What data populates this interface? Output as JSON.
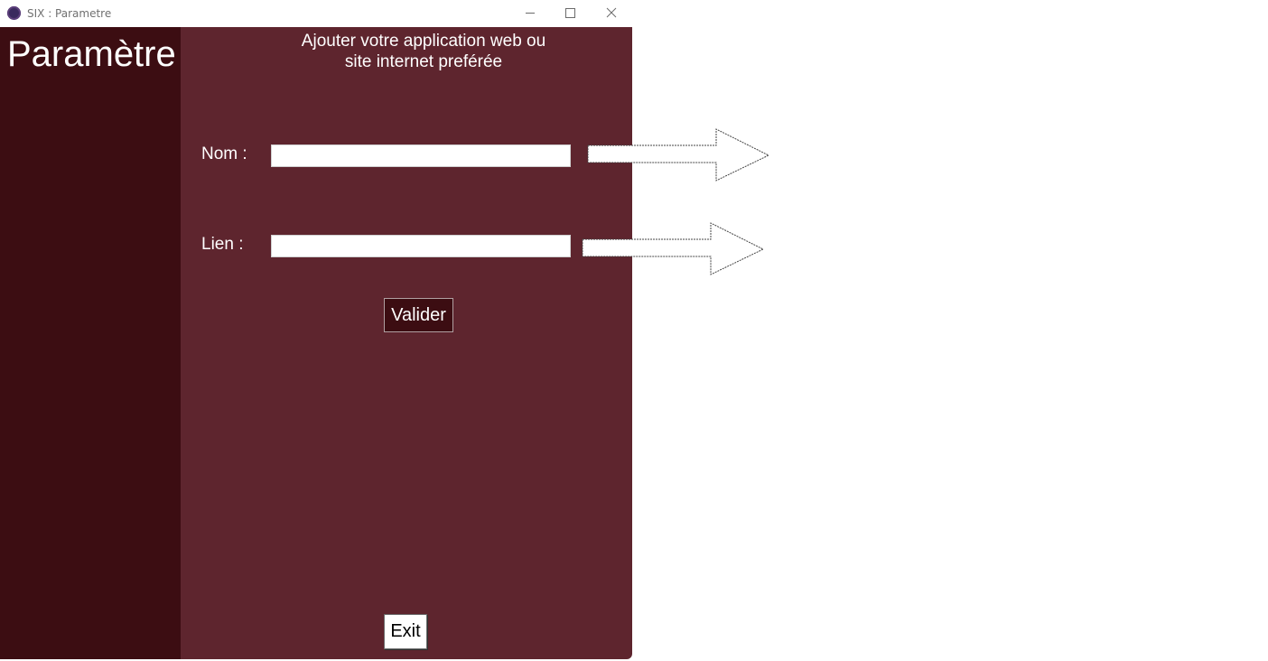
{
  "window": {
    "title": "SIX : Parametre",
    "minimize_glyph": "—",
    "maximize_glyph": "☐",
    "close_glyph": "✕"
  },
  "sidebar": {
    "title": "Paramètre"
  },
  "main": {
    "heading_line1": "Ajouter votre application web ou",
    "heading_line2": "site internet preférée",
    "name_label": "Nom :",
    "name_value": "",
    "link_label": "Lien :",
    "link_value": "",
    "submit_label": "Valider",
    "exit_label": "Exit"
  },
  "icons": {
    "app": "app-icon",
    "arrows": [
      "right-arrow-icon",
      "right-arrow-icon"
    ]
  },
  "colors": {
    "sidebar_bg": "#3c0d12",
    "main_bg": "#5e252e",
    "text": "#ffffff"
  }
}
